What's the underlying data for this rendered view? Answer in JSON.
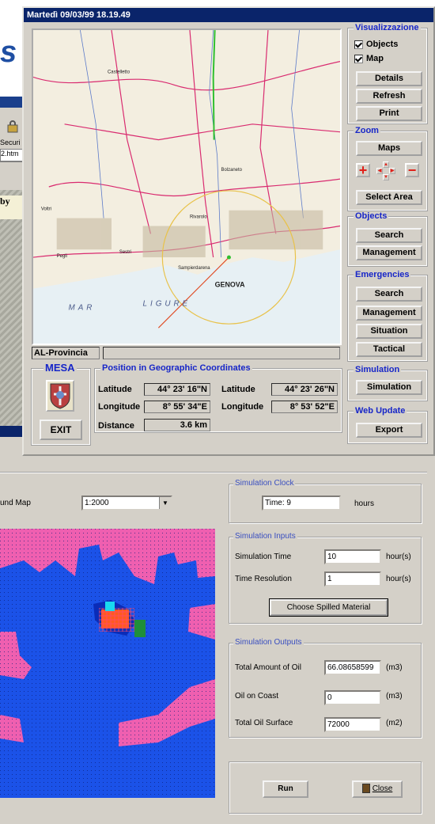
{
  "background": {
    "logo_fragment": "s",
    "toolbar_fragment": "Securi",
    "url_fragment": "2.htm",
    "by_fragment": "by"
  },
  "window": {
    "title": "Martedì 09/03/99  18.19.49"
  },
  "map": {
    "place_labels": [
      "GENOVA",
      "MAR",
      "LIGURE",
      "Castelletto",
      "Pegli",
      "Sestri",
      "Sampierdarena",
      "Voltri",
      "Bolzaneto",
      "Rivarolo"
    ],
    "colors": {
      "land": "#f3eee0",
      "sea": "#e7f0f4",
      "roads": "#d92a6f",
      "rivers": "#5b7ac9",
      "track": "#2fbf2f",
      "circle": "#e8c24a"
    }
  },
  "status_bar": {
    "region": "AL-Provincia",
    "message": ""
  },
  "visualizzazione": {
    "title": "Visualizzazione",
    "objects_label": "Objects",
    "objects_checked": true,
    "map_label": "Map",
    "map_checked": true,
    "details": "Details",
    "refresh": "Refresh",
    "print": "Print"
  },
  "zoom": {
    "title": "Zoom",
    "maps": "Maps",
    "plus": "+",
    "minus": "−",
    "select_area": "Select Area"
  },
  "objects": {
    "title": "Objects",
    "search": "Search",
    "management": "Management"
  },
  "emergencies": {
    "title": "Emergencies",
    "search": "Search",
    "management": "Management",
    "situation": "Situation",
    "tactical": "Tactical"
  },
  "mesa": {
    "title": "MESA",
    "exit": "EXIT"
  },
  "position": {
    "title": "Position in Geographic Coordinates",
    "lat1_label": "Latitude",
    "lat1_value": "44° 23' 16\"N",
    "lon1_label": "Longitude",
    "lon1_value": "8° 55' 34\"E",
    "lat2_label": "Latitude",
    "lat2_value": "44° 23' 26\"N",
    "lon2_label": "Longitude",
    "lon2_value": "8° 53' 52\"E",
    "distance_label": "Distance",
    "distance_value": "3.6 km"
  },
  "simulation_panel": {
    "title": "Simulation",
    "button": "Simulation"
  },
  "web_update": {
    "title": "Web Update",
    "button": "Export"
  },
  "sim_window": {
    "background_map_label": "und Map",
    "scale_value": "1:2000",
    "clock": {
      "title": "Simulation Clock",
      "value": "Time: 9",
      "unit": "hours"
    },
    "inputs": {
      "title": "Simulation Inputs",
      "time_label": "Simulation Time",
      "time_value": "10",
      "time_unit": "hour(s)",
      "resolution_label": "Time Resolution",
      "resolution_value": "1",
      "resolution_unit": "hour(s)",
      "choose_button": "Choose Spilled Material"
    },
    "outputs": {
      "title": "Simulation Outputs",
      "total_oil_label": "Total Amount of Oil",
      "total_oil_value": "66.08658599",
      "total_oil_unit": "(m3)",
      "coast_label": "Oil on Coast",
      "coast_value": "0",
      "coast_unit": "(m3)",
      "surface_label": "Total Oil Surface",
      "surface_value": "72000",
      "surface_unit": "(m2)"
    },
    "run_button": "Run",
    "close_button": "Close",
    "sim_colors": {
      "sea": "#1b52e8",
      "land": "#ef5fb0",
      "oil": "#ff5a1f",
      "cyan": "#19d8f0",
      "green": "#1f8f3a"
    }
  }
}
